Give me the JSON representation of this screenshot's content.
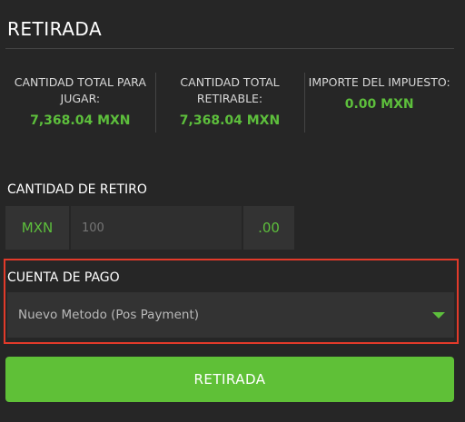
{
  "header": {
    "title": "RETIRADA"
  },
  "summary": [
    {
      "label": "CANTIDAD TOTAL PARA JUGAR:",
      "value": "7,368.04 MXN"
    },
    {
      "label": "CANTIDAD TOTAL RETIRABLE:",
      "value": "7,368.04 MXN"
    },
    {
      "label": "IMPORTE DEL IMPUESTO:",
      "value": "0.00 MXN"
    }
  ],
  "withdraw_amount": {
    "label": "CANTIDAD DE RETIRO",
    "currency": "MXN",
    "placeholder": "100",
    "value": "",
    "cents": ".00"
  },
  "payment_account": {
    "label": "CUENTA DE PAGO",
    "selected": "Nuevo Metodo (Pos Payment)",
    "icon": "chevron-down-icon"
  },
  "submit": {
    "label": "RETIRADA"
  },
  "colors": {
    "background": "#262626",
    "accent": "#5dbf3c",
    "button": "#5fc037",
    "highlight": "#e23a2a"
  }
}
